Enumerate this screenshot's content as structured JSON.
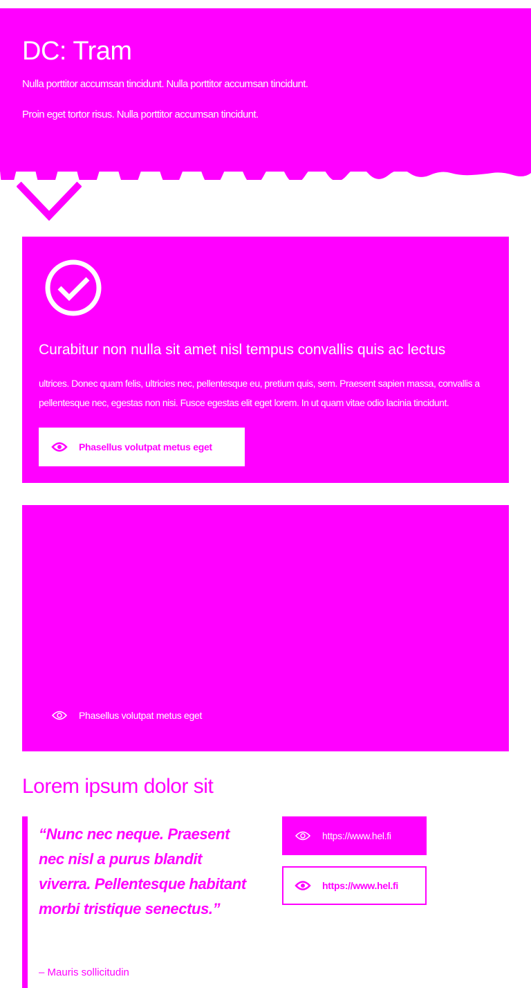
{
  "colors": {
    "accent": "#ff00ff",
    "background": "#ffffff"
  },
  "hero": {
    "title": "DC: Tram",
    "paragraph1": "Nulla porttitor accumsan tincidunt. Nulla porttitor accumsan tincidunt.",
    "paragraph2": "Proin eget tortor risus. Nulla porttitor accumsan tincidunt."
  },
  "card1": {
    "icon": "check-circle-icon",
    "title": "Curabitur non nulla sit amet nisl tempus convallis quis ac lectus",
    "text": "ultrices. Donec quam felis, ultricies nec, pellentesque eu, pretium quis, sem. Praesent sapien massa, convallis a pellentesque nec, egestas non nisi. Fusce egestas elit eget lorem. In ut quam vitae odio lacinia tincidunt.",
    "button_label": "Phasellus volutpat metus eget",
    "button_icon": "eye-icon"
  },
  "card2": {
    "link_label": "Phasellus volutpat metus eget",
    "link_icon": "eye-icon"
  },
  "section": {
    "title": "Lorem ipsum dolor sit",
    "quote": "“Nunc nec neque. Praesent nec nisl a purus blandit viverra. Pellentesque habitant morbi tristique senectus.”",
    "author": "– Mauris sollicitudin",
    "link1_label": "https://www.hel.fi",
    "link2_label": "https://www.hel.fi"
  }
}
